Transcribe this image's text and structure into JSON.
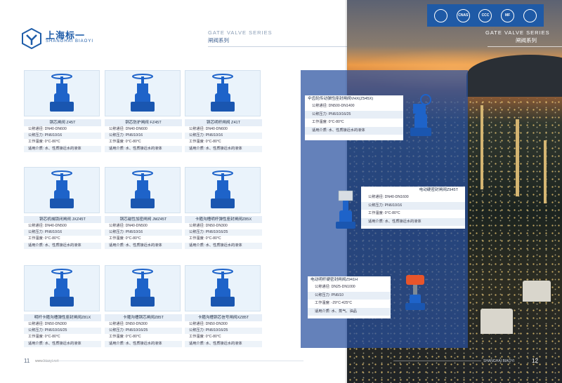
{
  "left_header": {
    "brand_name": "上海标一",
    "brand_sub": "SHANGHAI BIAOYI",
    "series_en": "GATE VALVE SERIES",
    "series_cn": "闸阀系列"
  },
  "right_header": {
    "series_en": "GATE VALVE SERIES",
    "series_cn": "闸阀系列",
    "certs": [
      "",
      "CNAS",
      "CCC",
      "MF",
      ""
    ]
  },
  "products": [
    {
      "name": "铜芯闸阀 Z45T",
      "specs": [
        "公称通径: DN40-DN600",
        "公称压力: PN6/10/16",
        "工作温度: 0°C-80°C",
        "适用介质: 水、性质接近水的液体"
      ]
    },
    {
      "name": "铜芯防护闸阀 FZ45T",
      "specs": [
        "公称通径: DN40-DN600",
        "公称压力: PN6/10/16",
        "工作温度: 0°C-80°C",
        "适用介质: 水、性质接近水的液体"
      ]
    },
    {
      "name": "铜芯明杆闸阀 Z41T",
      "specs": [
        "公称通径: DN40-DN600",
        "公称压力: PN6/10/16",
        "工作温度: 0°C-80°C",
        "适用介质: 水、性质接近水的液体"
      ]
    },
    {
      "name": "铜芯机械锁闭闸阀 JXZ45T",
      "specs": [
        "公称通径: DN40-DN500",
        "公称压力: PN6/10/16",
        "工作温度: 0°C-80°C",
        "适用介质: 水、性质接近水的液体"
      ]
    },
    {
      "name": "铜芯磁性加密闸阀 JMZ45T",
      "specs": [
        "公称通径: DN40-DN500",
        "公称压力: PN6/10/16",
        "工作温度: 0°C-80°C",
        "适用介质: 水、性质接近水的液体"
      ]
    },
    {
      "name": "卡箍沟槽明杆弹性座封闸阀Z85X",
      "specs": [
        "公称通径: DN50-DN300",
        "公称压力: PN6/10/16/25",
        "工作温度: 0°C-80°C",
        "适用介质: 水、性质接近水的液体"
      ]
    },
    {
      "name": "明杆卡箍沟槽弹性座封闸阀Z81X",
      "specs": [
        "公称通径: DN50-DN300",
        "公称压力: PN6/10/16/25",
        "工作温度: 0°C-80°C",
        "适用介质: 水、性质接近水的液体"
      ]
    },
    {
      "name": "卡箍沟槽铜芯闸阀Z85T",
      "specs": [
        "公称通径: DN50-DN300",
        "公称压力: PN6/10/16/25",
        "工作温度: 0°C-80°C",
        "适用介质: 水、性质接近水的液体"
      ]
    },
    {
      "name": "卡箍沟槽铜芯信号闸阀XZ85T",
      "specs": [
        "公称通径: DN50-DN300",
        "公称压力: PN6/10/16/25",
        "工作温度: 0°C-80°C",
        "适用介质: 水、性质接近水的液体"
      ]
    }
  ],
  "panel_products": [
    {
      "name": "伞齿轮传动弹性座封闸阀VHX(Z545X)",
      "specs": [
        "公称通径: DN500-DN1400",
        "公称压力: PN6/10/16/25",
        "工作温度: 0°C-80°C",
        "适用介质: 水、性质接近水的液体"
      ]
    },
    {
      "name": "电动硬密封闸阀Z945T",
      "specs": [
        "公称通径: DN40-DN1600",
        "公称压力: PN6/10/16",
        "工作温度: 0°C-80°C",
        "适用介质: 水、性质接近水的液体"
      ]
    },
    {
      "name": "电动明杆硬密封闸阀Z941H",
      "specs": [
        "公称通径: DN25-DN1000",
        "公称压力: PN6/10",
        "工作温度: -29°C-425°C",
        "适用介质: 水、蒸气、油品"
      ]
    }
  ],
  "footer": {
    "left_page_num": "11",
    "left_url": "www.biaoyi.net",
    "right_brand": "SHANGHAI BIAOYI",
    "right_page_num": "12"
  },
  "colors": {
    "brand_blue": "#1f5da9",
    "valve_blue": "#1e63c9",
    "panel_blue": "#2a52a0"
  }
}
